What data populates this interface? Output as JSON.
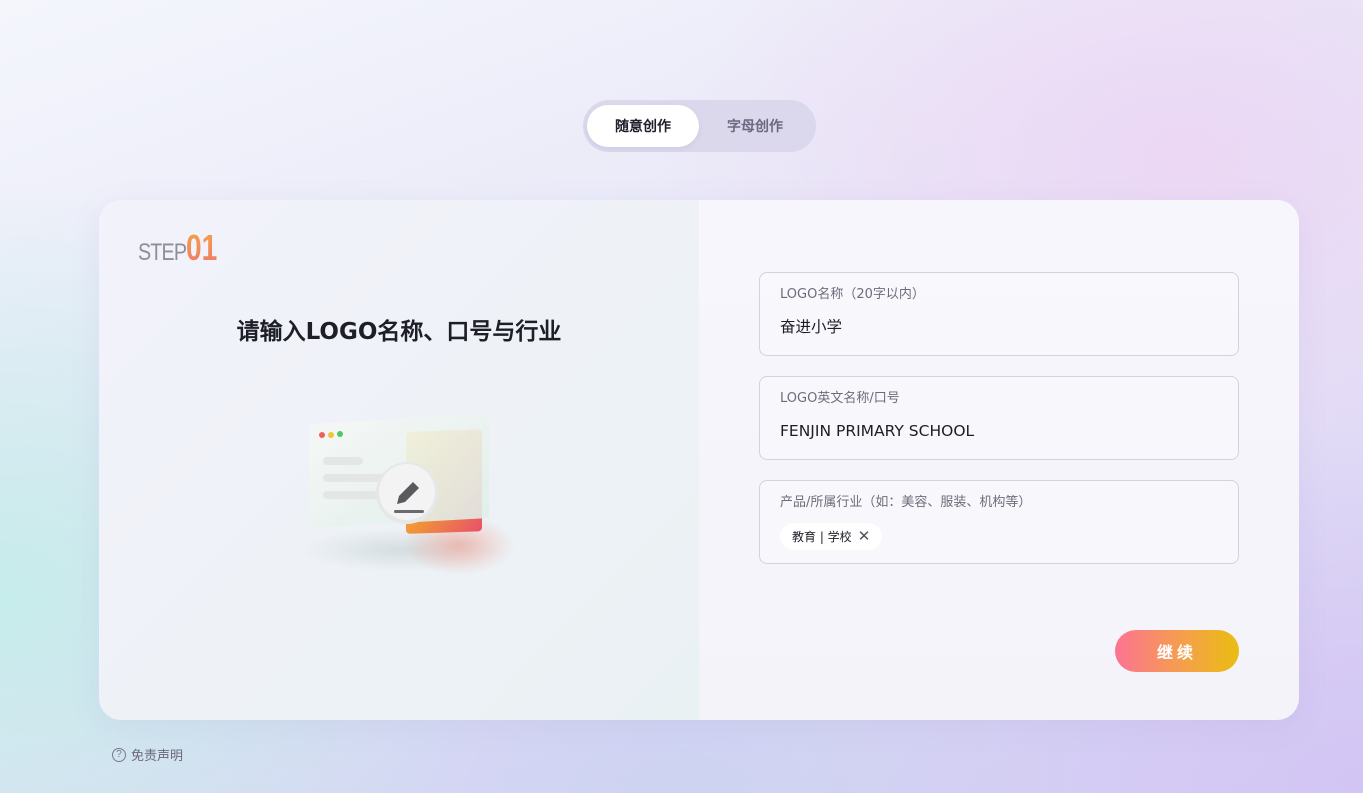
{
  "mode_tabs": [
    {
      "label": "随意创作",
      "active": true
    },
    {
      "label": "字母创作",
      "active": false
    }
  ],
  "step": {
    "word": "STEP",
    "number": "01"
  },
  "left": {
    "title": "请输入LOGO名称、口号与行业",
    "illustration": "edit-document-illustration"
  },
  "form": {
    "name_field": {
      "label": "LOGO名称（20字以内）",
      "value": "奋进小学"
    },
    "slogan_field": {
      "label": "LOGO英文名称/口号",
      "value": "FENJIN PRIMARY SCHOOL"
    },
    "industry_field": {
      "label": "产品/所属行业（如：美容、服装、机构等）",
      "tags": [
        {
          "label": "教育 | 学校"
        }
      ]
    },
    "continue_label": "继续"
  },
  "disclaimer": {
    "label": "免责声明",
    "icon": "help-circle-icon"
  },
  "colors": {
    "button_gradient_start": "#fc7392",
    "button_gradient_end": "#eabd11",
    "step_number_top": "#f3a24a",
    "step_number_bottom": "#ef7a6a"
  }
}
